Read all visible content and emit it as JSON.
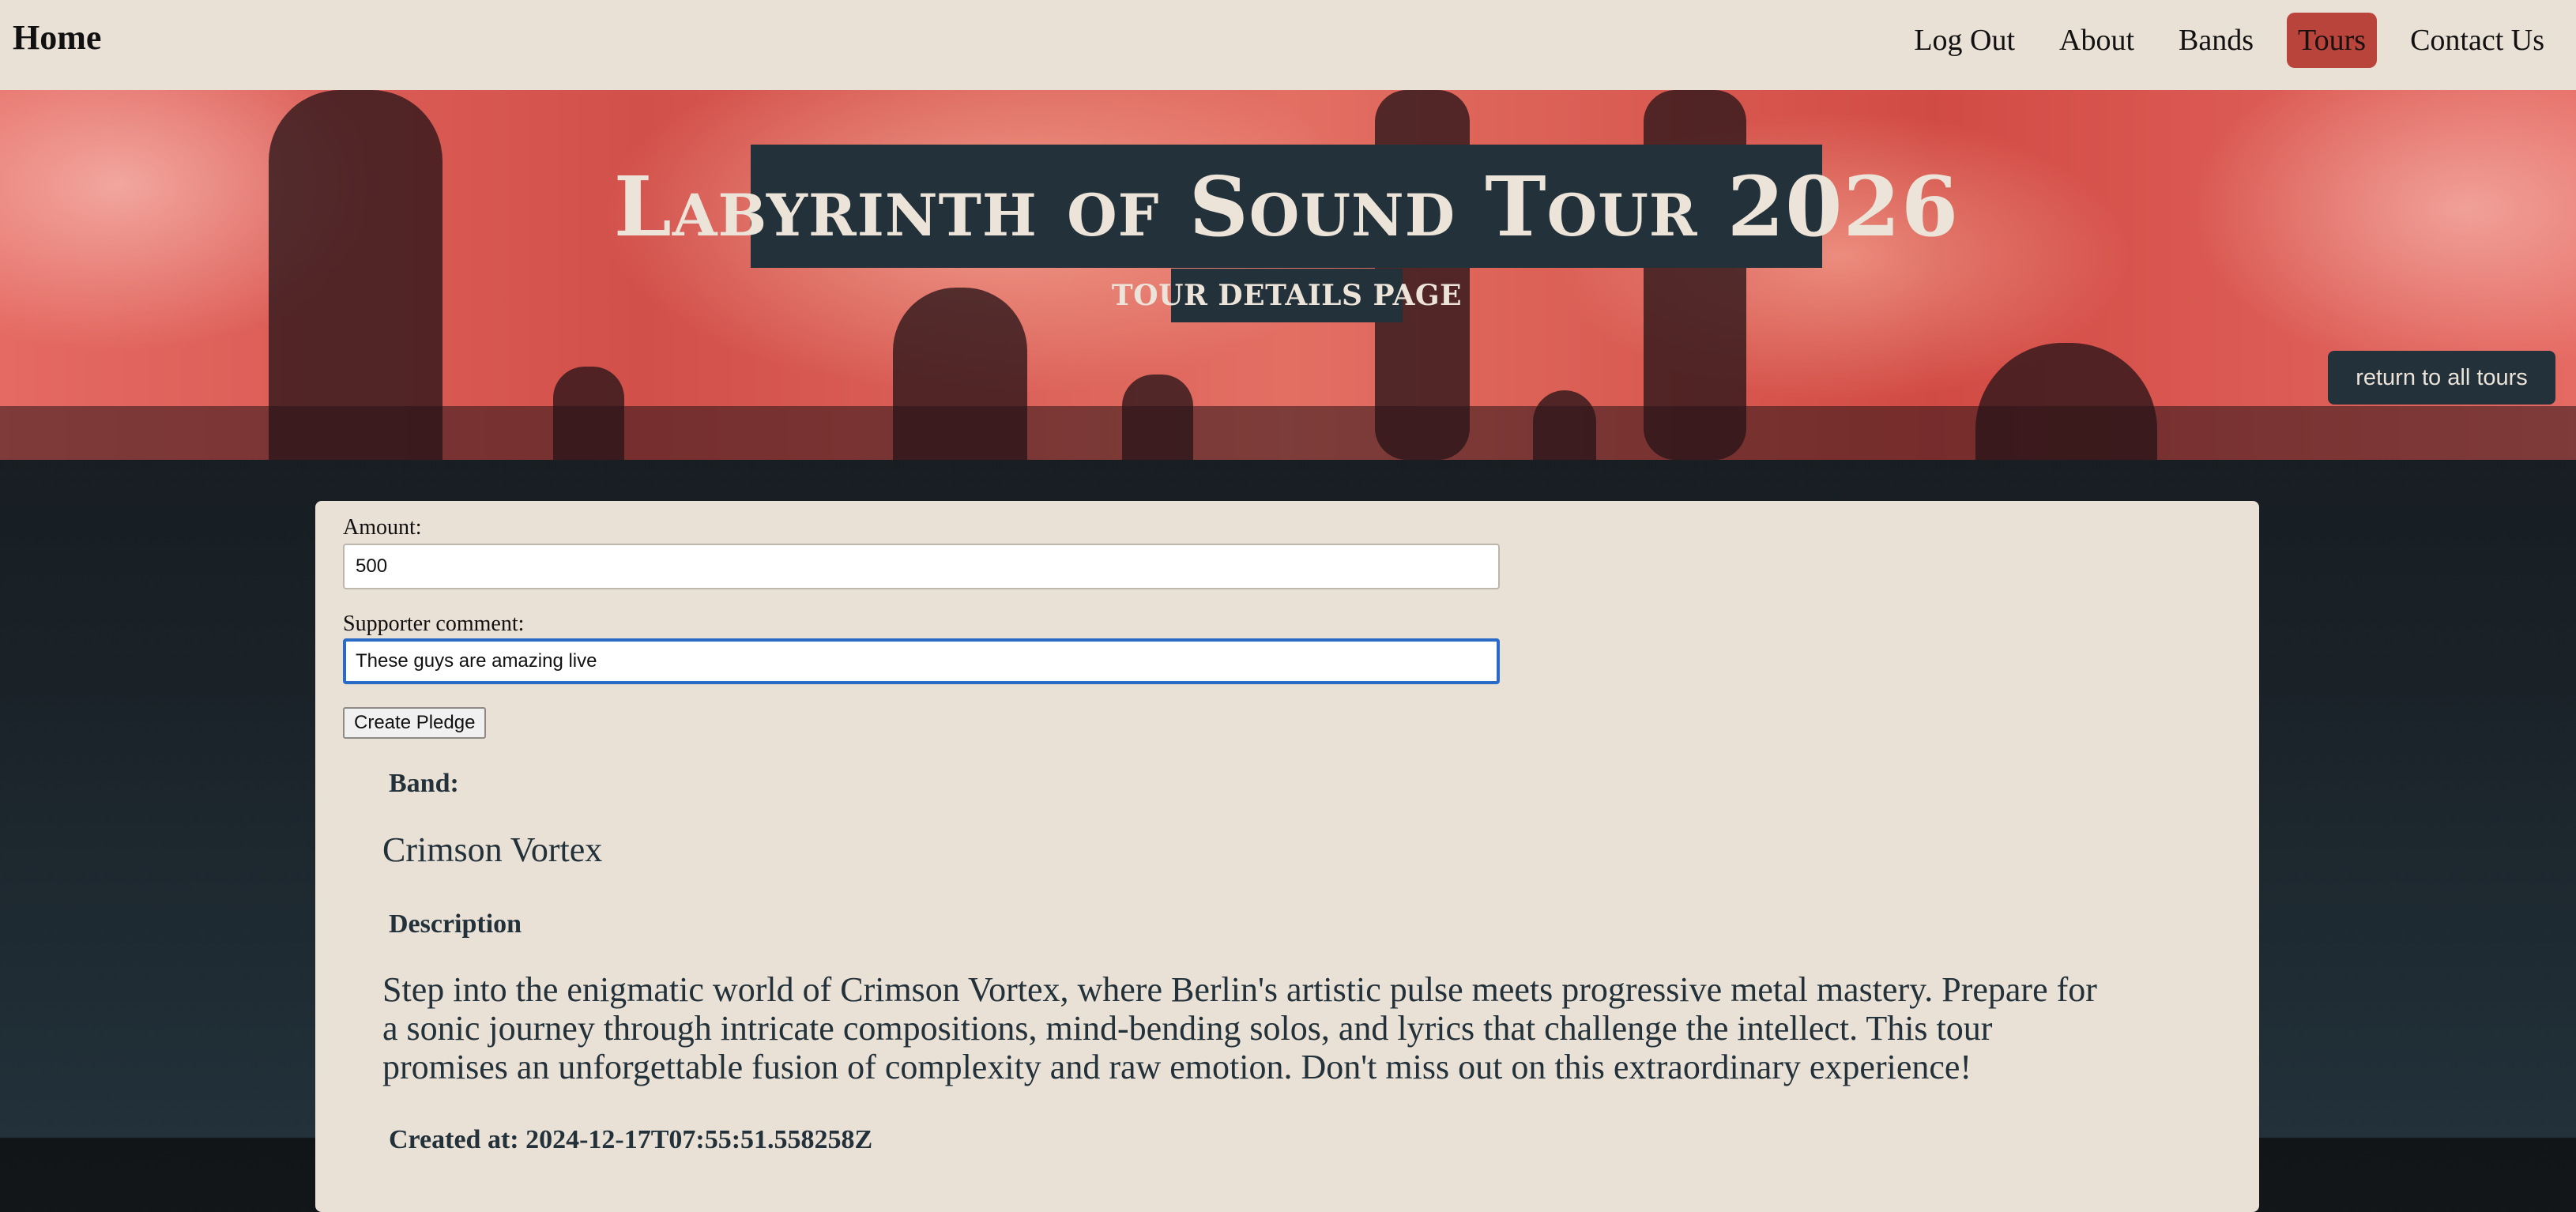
{
  "nav": {
    "home": "Home",
    "links": [
      {
        "label": "Log Out"
      },
      {
        "label": "About"
      },
      {
        "label": "Bands"
      },
      {
        "label": "Tours",
        "active": true
      },
      {
        "label": "Contact Us"
      }
    ]
  },
  "hero": {
    "title": "Labyrinth of Sound Tour 2026",
    "subtitle": "TOUR DETAILS PAGE",
    "return_button": "return to all tours"
  },
  "form": {
    "amount_label": "Amount:",
    "amount_value": "500",
    "comment_label": "Supporter comment:",
    "comment_value": "These guys are amazing live",
    "submit_label": "Create Pledge"
  },
  "details": {
    "band_heading": "Band:",
    "band_name": "Crimson Vortex",
    "description_heading": "Description",
    "description": "Step into the enigmatic world of Crimson Vortex, where Berlin's artistic pulse meets progressive metal mastery. Prepare for a sonic journey through intricate compositions, mind-bending solos, and lyrics that challenge the intellect. This tour promises an unforgettable fusion of complexity and raw emotion. Don't miss out on this extraordinary experience!",
    "created_partial": "Created at: 2024-12-17T07:55:51.558258Z"
  },
  "colors": {
    "nav_bg": "#e9e0d6",
    "accent": "#b9443b",
    "dark": "#22313a",
    "card_bg": "#e9e0d6",
    "focus": "#2a6bc7"
  }
}
